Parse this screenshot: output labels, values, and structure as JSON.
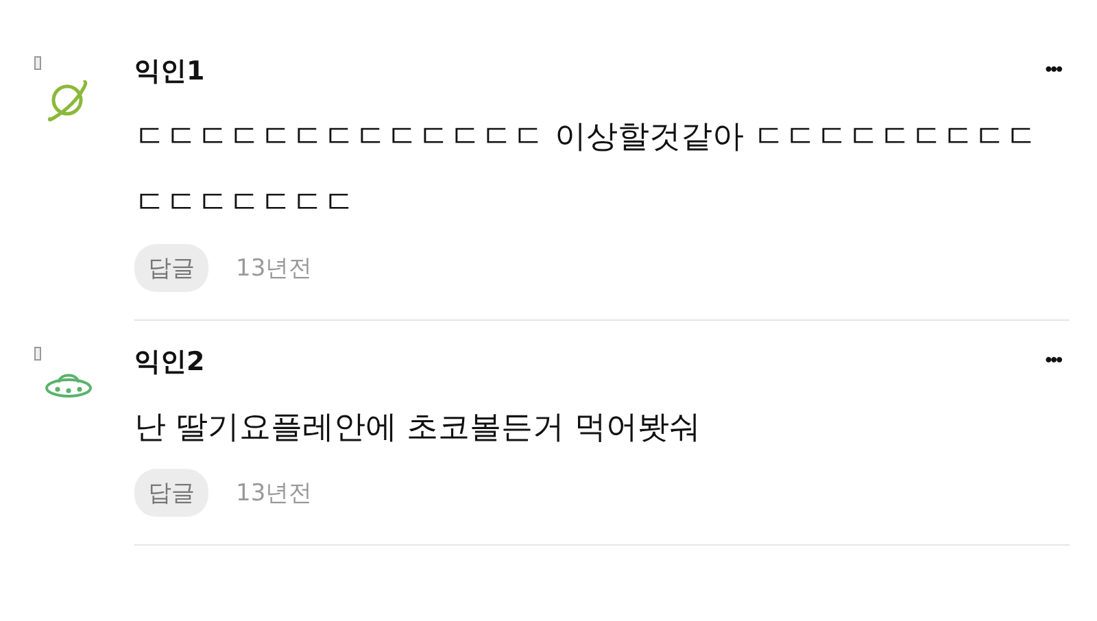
{
  "comments": [
    {
      "avatar": {
        "kind": "planet",
        "color": "#8bb83a"
      },
      "author": "익인1",
      "text": "ㄷㄷㄷㄷㄷㄷㄷㄷㄷㄷㄷㄷㄷ 이상할것같아 ㄷㄷㄷㄷㄷㄷㄷㄷㄷㄷㄷㄷㄷㄷㄷㄷ",
      "more": "•••",
      "reply": "답글",
      "time": "13년전"
    },
    {
      "avatar": {
        "kind": "ufo",
        "color": "#5bb26c"
      },
      "author": "익인2",
      "text": "난 딸기요플레안에 초코볼든거 먹어봣숴",
      "more": "•••",
      "reply": "답글",
      "time": "13년전"
    }
  ]
}
